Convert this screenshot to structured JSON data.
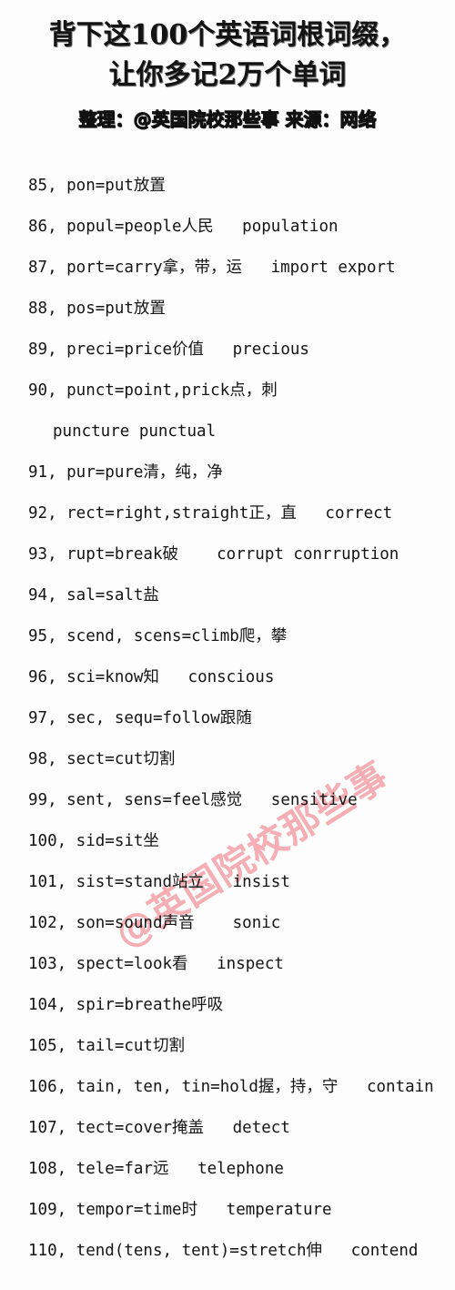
{
  "header": {
    "title_line1": "背下这100个英语词根词缀，",
    "title_line2": "让你多记2万个单词",
    "subtitle": "整理：@英国院校那些事 来源：网络"
  },
  "watermark": {
    "text": "@英国院校那些事",
    "color": "#f4a8ae"
  },
  "colors": {
    "background": "#fdfdfd",
    "text": "#141414",
    "watermark": "#f4a8ae"
  },
  "list": {
    "entries": [
      {
        "num": "85",
        "text": "85, pon=put放置"
      },
      {
        "num": "86",
        "text": "86, popul=people人民   population"
      },
      {
        "num": "87",
        "text": "87, port=carry拿，带，运   import export"
      },
      {
        "num": "88",
        "text": "88, pos=put放置"
      },
      {
        "num": "89",
        "text": "89, preci=price价值   precious"
      },
      {
        "num": "90",
        "text": "90, punct=point,prick点，刺"
      },
      {
        "num": "90b",
        "text": "puncture punctual",
        "continuation": true
      },
      {
        "num": "91",
        "text": "91, pur=pure清，纯，净"
      },
      {
        "num": "92",
        "text": "92, rect=right,straight正，直   correct"
      },
      {
        "num": "93",
        "text": "93, rupt=break破    corrupt conrruption"
      },
      {
        "num": "94",
        "text": "94, sal=salt盐"
      },
      {
        "num": "95",
        "text": "95, scend, scens=climb爬，攀"
      },
      {
        "num": "96",
        "text": "96, sci=know知   conscious"
      },
      {
        "num": "97",
        "text": "97, sec, sequ=follow跟随"
      },
      {
        "num": "98",
        "text": "98, sect=cut切割"
      },
      {
        "num": "99",
        "text": "99, sent, sens=feel感觉   sensitive"
      },
      {
        "num": "100",
        "text": "100, sid=sit坐"
      },
      {
        "num": "101",
        "text": "101, sist=stand站立   insist"
      },
      {
        "num": "102",
        "text": "102, son=sound声音    sonic"
      },
      {
        "num": "103",
        "text": "103, spect=look看   inspect"
      },
      {
        "num": "104",
        "text": "104, spir=breathe呼吸"
      },
      {
        "num": "105",
        "text": "105, tail=cut切割"
      },
      {
        "num": "106",
        "text": "106, tain, ten, tin=hold握，持，守   contain"
      },
      {
        "num": "107",
        "text": "107, tect=cover掩盖   detect"
      },
      {
        "num": "108",
        "text": "108, tele=far远   telephone"
      },
      {
        "num": "109",
        "text": "109, tempor=time时   temperature"
      },
      {
        "num": "110",
        "text": "110, tend(tens, tent)=stretch伸   contend"
      }
    ]
  }
}
